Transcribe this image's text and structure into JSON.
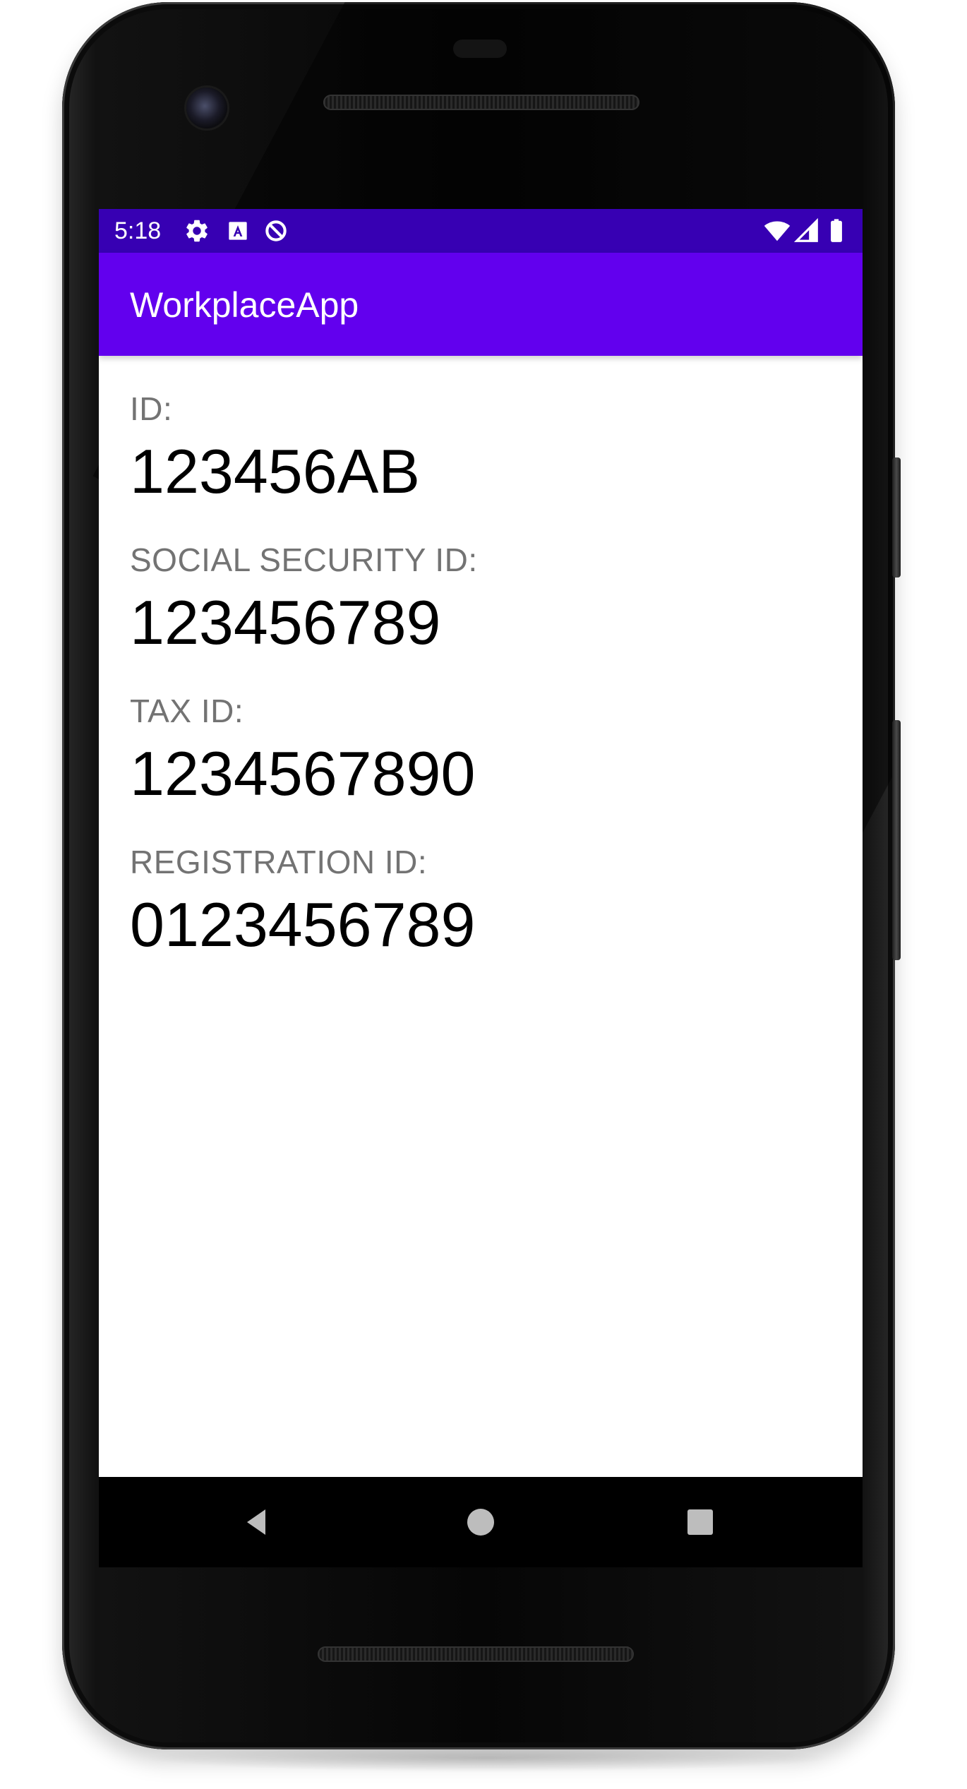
{
  "status_bar": {
    "time": "5:18",
    "icons_left": [
      "settings-icon",
      "text-a-icon",
      "data-saver-icon"
    ],
    "icons_right": [
      "wifi-icon",
      "cellular-signal-icon",
      "battery-icon"
    ],
    "background": "#3700b3"
  },
  "app_bar": {
    "title": "WorkplaceApp",
    "background": "#6200ee"
  },
  "fields": [
    {
      "label": "ID:",
      "value": "123456AB"
    },
    {
      "label": "SOCIAL SECURITY ID:",
      "value": "123456789"
    },
    {
      "label": "TAX ID:",
      "value": "1234567890"
    },
    {
      "label": "REGISTRATION ID:",
      "value": "0123456789"
    }
  ],
  "nav_bar": {
    "buttons": [
      "back-icon",
      "home-icon",
      "recents-icon"
    ]
  },
  "colors": {
    "label": "#737373",
    "value": "#000000"
  }
}
